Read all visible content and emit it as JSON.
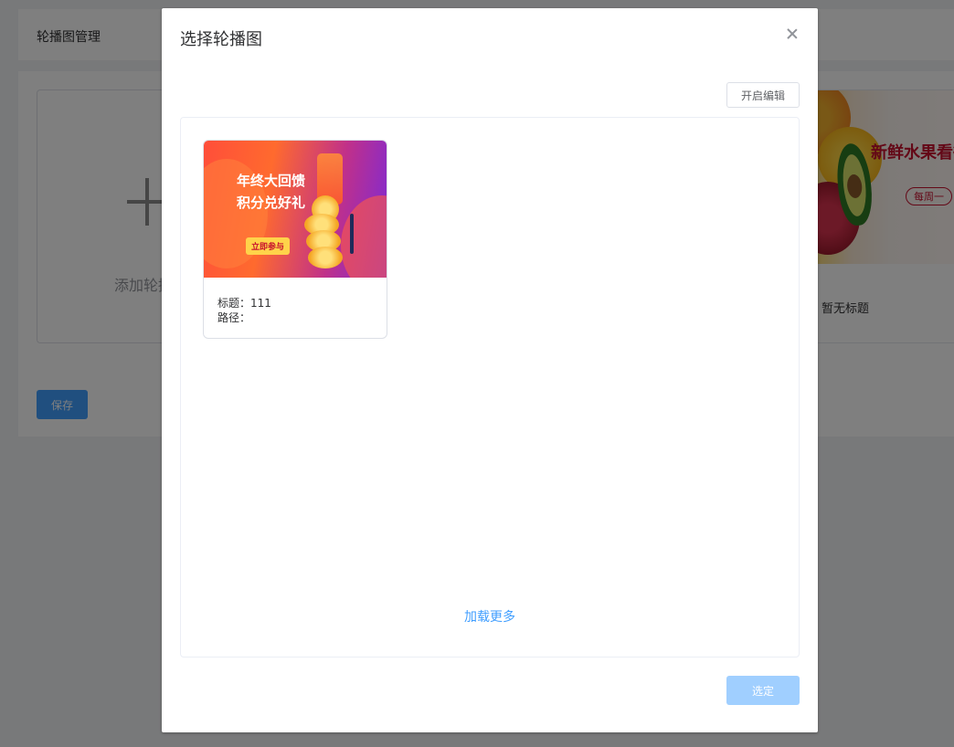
{
  "page": {
    "title": "轮播图管理",
    "add_label": "添加轮播图",
    "save_label": "保存",
    "existing_banner": {
      "image_title": "新鲜水果看得见",
      "image_tag": "每周一",
      "caption": "暂无标题"
    }
  },
  "dialog": {
    "title": "选择轮播图",
    "edit_label": "开启编辑",
    "items": [
      {
        "image_text": "年终大回馈 积分兑好礼",
        "image_cta": "立即参与",
        "title_label": "标题：",
        "title_value": "111",
        "path_label": "路径：",
        "path_value": ""
      }
    ],
    "load_more_label": "加载更多",
    "confirm_label": "选定"
  }
}
